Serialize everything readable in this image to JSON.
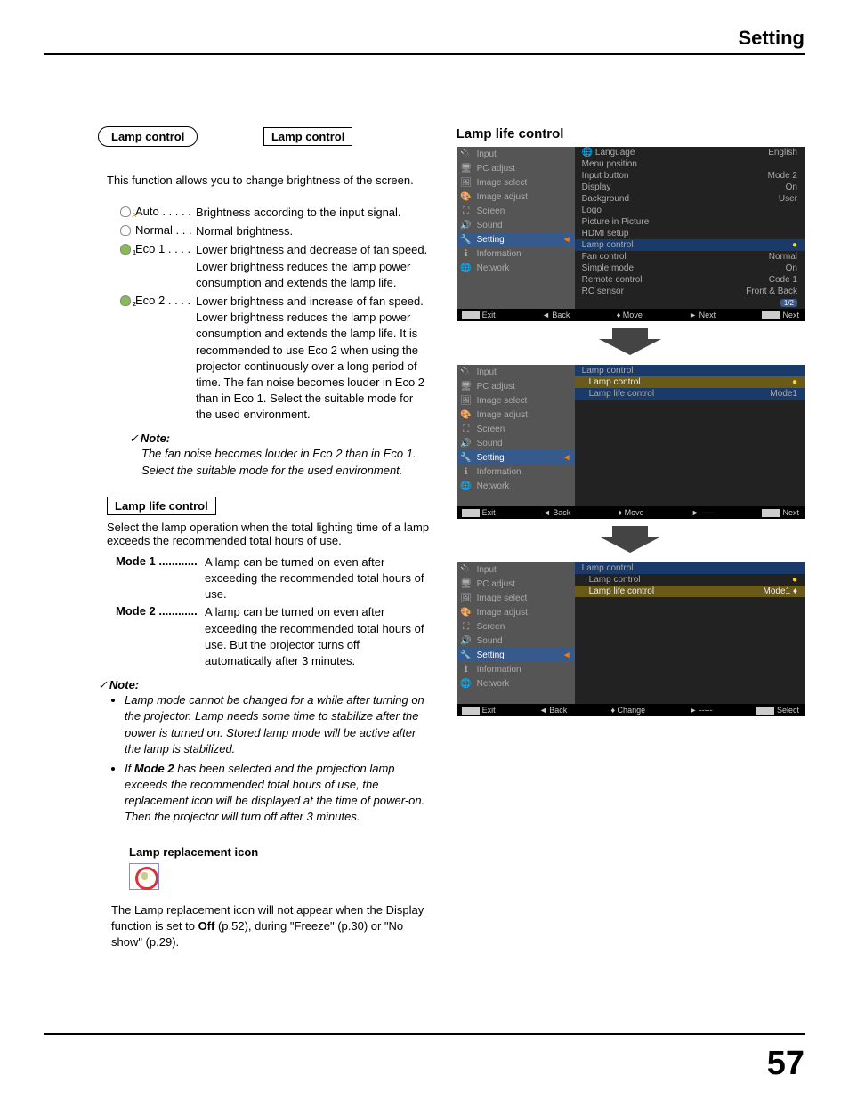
{
  "header": "Setting",
  "page_number": "57",
  "pill_title": "Lamp control",
  "section_lamp_control": {
    "heading": "Lamp control",
    "intro": "This function allows you to change brightness of the screen.",
    "options": [
      {
        "name": "Auto  . . . . .",
        "desc": "Brightness according to the input signal."
      },
      {
        "name": "Normal  . . .",
        "desc": "Normal brightness."
      },
      {
        "name": "Eco 1  . . . .",
        "desc": "Lower brightness and decrease of fan speed. Lower brightness reduces the lamp power consumption and extends the lamp life."
      },
      {
        "name": "Eco 2  . . . .",
        "desc": "Lower brightness and increase of fan speed. Lower brightness reduces the lamp power consumption and extends the lamp life. It is recommended to use Eco 2 when using the projector continuously over a long period of time. The fan noise becomes louder in Eco 2 than in Eco 1. Select the suitable mode for the used environment."
      }
    ],
    "note_label": "Note:",
    "note_text": "The fan noise becomes louder in Eco 2 than in Eco 1. Select the suitable mode for the used environment."
  },
  "section_lamp_life": {
    "heading": "Lamp life control",
    "intro": "Select the lamp operation when the total lighting time of a lamp exceeds the recommended total hours of use.",
    "modes": [
      {
        "name": "Mode 1 ............",
        "desc": "A lamp can be turned on even after exceeding the recommended total hours of use."
      },
      {
        "name": "Mode 2 ............",
        "desc": "A lamp can be turned on even after exceeding the recommended total hours of use. But the projector turns off automatically after 3 minutes."
      }
    ],
    "note_label": "Note:",
    "notes": [
      "Lamp mode cannot be changed for a while after turning on the projector. Lamp needs some time to stabilize after the power is turned on. Stored lamp mode will be active after the lamp is stabilized.",
      "If Mode 2 has been selected and the projection lamp exceeds the recommended total hours of use, the replacement icon will be displayed at the time of power-on. Then the projector will turn off after 3 minutes."
    ],
    "replacement_title": "Lamp replacement icon",
    "replacement_text_1": "The Lamp replacement icon will not appear when the Display function is set to ",
    "replacement_off": "Off",
    "replacement_text_2": " (p.52), during \"Freeze\" (p.30) or \"No show\" (p.29)."
  },
  "right_title": "Lamp life control",
  "osd_nav": [
    "Input",
    "PC adjust",
    "Image select",
    "Image adjust",
    "Screen",
    "Sound",
    "Setting",
    "Information",
    "Network"
  ],
  "osd1_content": [
    {
      "l": "Language",
      "r": "English",
      "icon": true
    },
    {
      "l": "Menu position",
      "r": ""
    },
    {
      "l": "Input button",
      "r": "Mode 2"
    },
    {
      "l": "Display",
      "r": "On"
    },
    {
      "l": "Background",
      "r": "User"
    },
    {
      "l": "Logo",
      "r": ""
    },
    {
      "l": "Picture in Picture",
      "r": ""
    },
    {
      "l": "HDMI setup",
      "r": ""
    },
    {
      "l": "Lamp control",
      "r": "●",
      "hl": true
    },
    {
      "l": "Fan control",
      "r": "Normal"
    },
    {
      "l": "Simple mode",
      "r": "On"
    },
    {
      "l": "Remote control",
      "r": "Code 1"
    },
    {
      "l": "RC sensor",
      "r": "Front & Back"
    },
    {
      "l": "",
      "r": "1/2",
      "badge": true
    }
  ],
  "osd1_footer": {
    "a": "Exit",
    "b": "◄ Back",
    "c": "♦ Move",
    "d": "► Next",
    "e": "Next"
  },
  "osd2_header": "Lamp control",
  "osd2_content": [
    {
      "l": "Lamp control",
      "r": "●",
      "sel": true
    },
    {
      "l": "Lamp life control",
      "r": "Mode1",
      "hl": true
    }
  ],
  "osd2_footer": {
    "a": "Exit",
    "b": "◄ Back",
    "c": "♦ Move",
    "d": "► -----",
    "e": "Next"
  },
  "osd3_header": "Lamp control",
  "osd3_content": [
    {
      "l": "Lamp control",
      "r": "●"
    },
    {
      "l": "Lamp life control",
      "r": "Mode1 ♦",
      "sel": true
    }
  ],
  "osd3_footer": {
    "a": "Exit",
    "b": "◄ Back",
    "c": "♦ Change",
    "d": "► -----",
    "e": "Select"
  }
}
